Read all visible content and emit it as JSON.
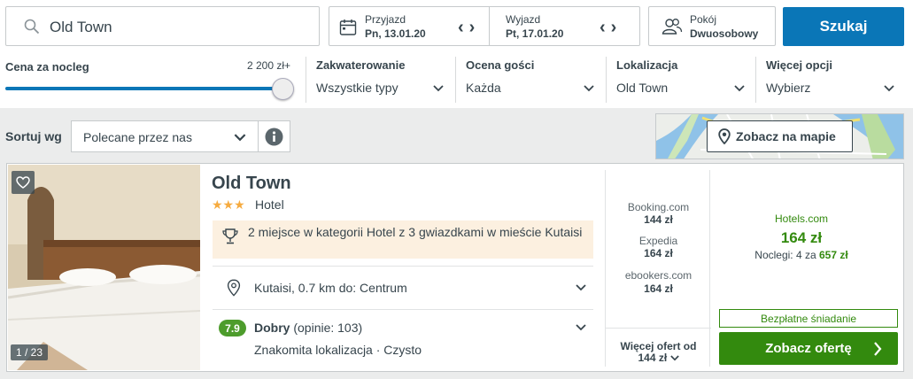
{
  "search": {
    "destination": "Old Town"
  },
  "dates": {
    "checkin_label": "Przyjazd",
    "checkin_value": "Pn, 13.01.20",
    "checkout_label": "Wyjazd",
    "checkout_value": "Pt, 17.01.20"
  },
  "rooms": {
    "label": "Pokój",
    "value": "Dwuosobowy"
  },
  "search_button": "Szukaj",
  "filters": {
    "price": {
      "title": "Cena za nocleg",
      "max": "2 200 zł+",
      "level_fraction": 1.0
    },
    "accommodation": {
      "title": "Zakwaterowanie",
      "value": "Wszystkie typy"
    },
    "guest_rating": {
      "title": "Ocena gości",
      "value": "Każda"
    },
    "location": {
      "title": "Lokalizacja",
      "value": "Old Town"
    },
    "more": {
      "title": "Więcej opcji",
      "value": "Wybierz"
    }
  },
  "sort": {
    "label": "Sortuj wg",
    "value": "Polecane przez nas"
  },
  "map_button": "Zobacz na mapie",
  "hotel": {
    "name": "Old Town",
    "stars": "★★★",
    "star_count": 3,
    "type": "Hotel",
    "photo_counter": "1 / 23",
    "award": "2 miejsce w kategorii Hotel z 3 gwiazdkami w mieście Kutaisi",
    "location": "Kutaisi, 0.7 km do: Centrum",
    "rating_score": "7.9",
    "rating_word": "Dobry",
    "rating_reviews": "(opinie: 103)",
    "rating_tags": "Znakomita lokalizacja · Czysto"
  },
  "other_offers": [
    {
      "site": "Booking.com",
      "price": "144 zł"
    },
    {
      "site": "Expedia",
      "price": "164 zł"
    },
    {
      "site": "ebookers.com",
      "price": "164 zł"
    }
  ],
  "more_offers": {
    "line1": "Więcej ofert od",
    "line2": "144 zł"
  },
  "deal": {
    "site": "Hotels.com",
    "price": "164 zł",
    "nights_prefix": "Noclegi: 4 za",
    "nights_total": "657 zł",
    "breakfast": "Bezpłatne śniadanie",
    "button": "Zobacz ofertę"
  },
  "colors": {
    "accent_blue": "#0a76b7",
    "deal_green": "#338a0e",
    "rating_green": "#4d9c2c",
    "star": "#f6ab3f"
  }
}
